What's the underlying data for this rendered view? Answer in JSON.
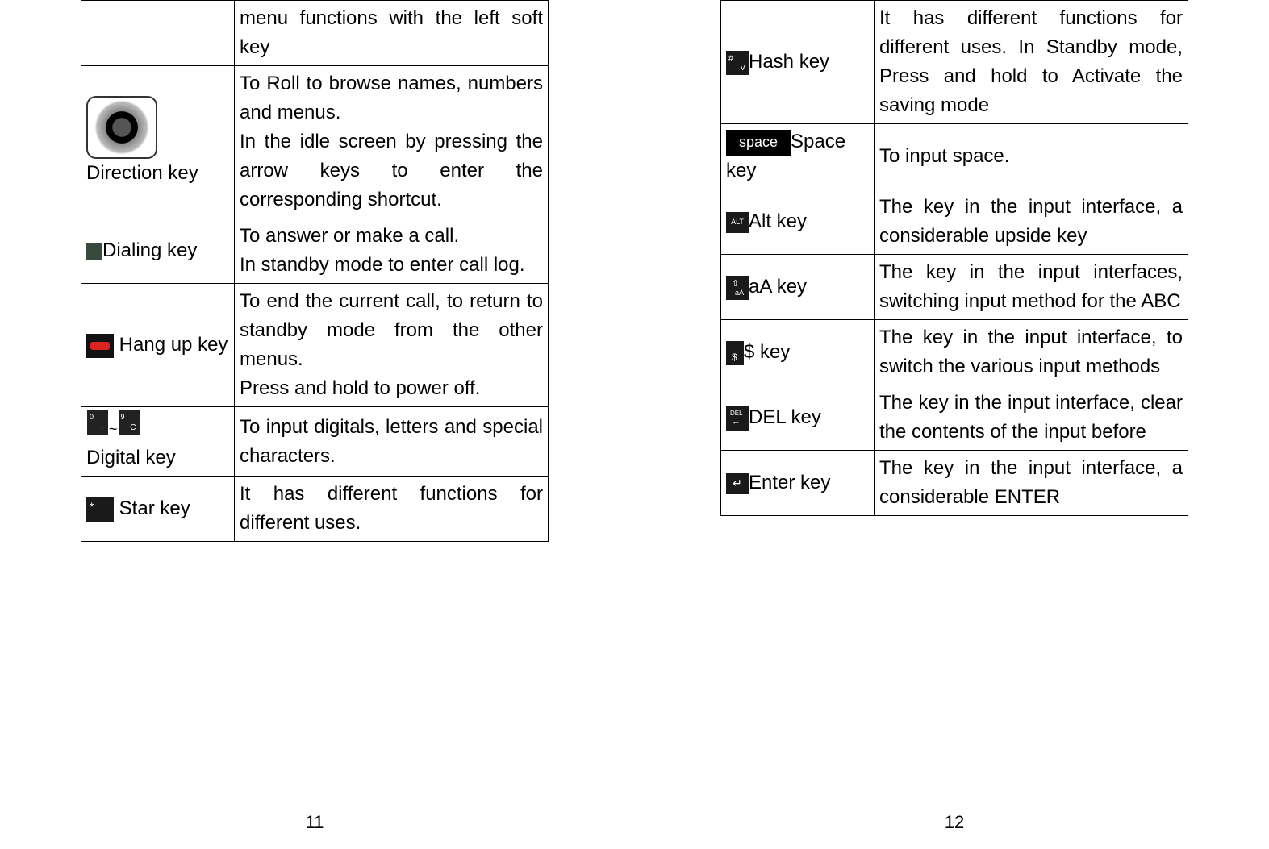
{
  "page_left": {
    "rows": [
      {
        "key": "",
        "desc": "menu functions with the left soft key"
      },
      {
        "key": "Direction key",
        "desc": "To Roll to browse names, numbers and menus.\nIn the idle screen by pressing the arrow keys to enter the corresponding shortcut."
      },
      {
        "key": "Dialing key",
        "desc": "To answer or make a call.\nIn standby mode to enter call log."
      },
      {
        "key": " Hang up key",
        "desc": "To end the current call, to return to standby mode from the other menus.\nPress and hold to power off."
      },
      {
        "key": "Digital key",
        "desc": "To input digitals, letters and special characters."
      },
      {
        "key": "  Star key",
        "desc": "It has different functions for different uses."
      }
    ],
    "page_num": "11"
  },
  "page_right": {
    "rows": [
      {
        "key": "Hash key",
        "desc": "It has different functions for different uses. In Standby mode, Press and hold to Activate the saving mode"
      },
      {
        "key": "Space key",
        "desc": "To input space."
      },
      {
        "key": "Alt key",
        "desc": "The key in the input interface, a considerable upside key"
      },
      {
        "key": "aA key",
        "desc": "The key in the input interfaces, switching input method for the ABC"
      },
      {
        "key": "$ key",
        "desc": "The key in the input interface, to switch the various input methods"
      },
      {
        "key": "DEL key",
        "desc": "The key in the input interface, clear the contents of the input before"
      },
      {
        "key": "Enter key",
        "desc": "The key in the input interface, a considerable ENTER"
      }
    ],
    "page_num": "12"
  },
  "icons": {
    "space_label": "space",
    "alt_label": "ALT",
    "digkey0_top": "0",
    "digkey0_bot": "−",
    "digkey9_top": "9",
    "digkey9_bot": "C",
    "tilde": "~"
  }
}
